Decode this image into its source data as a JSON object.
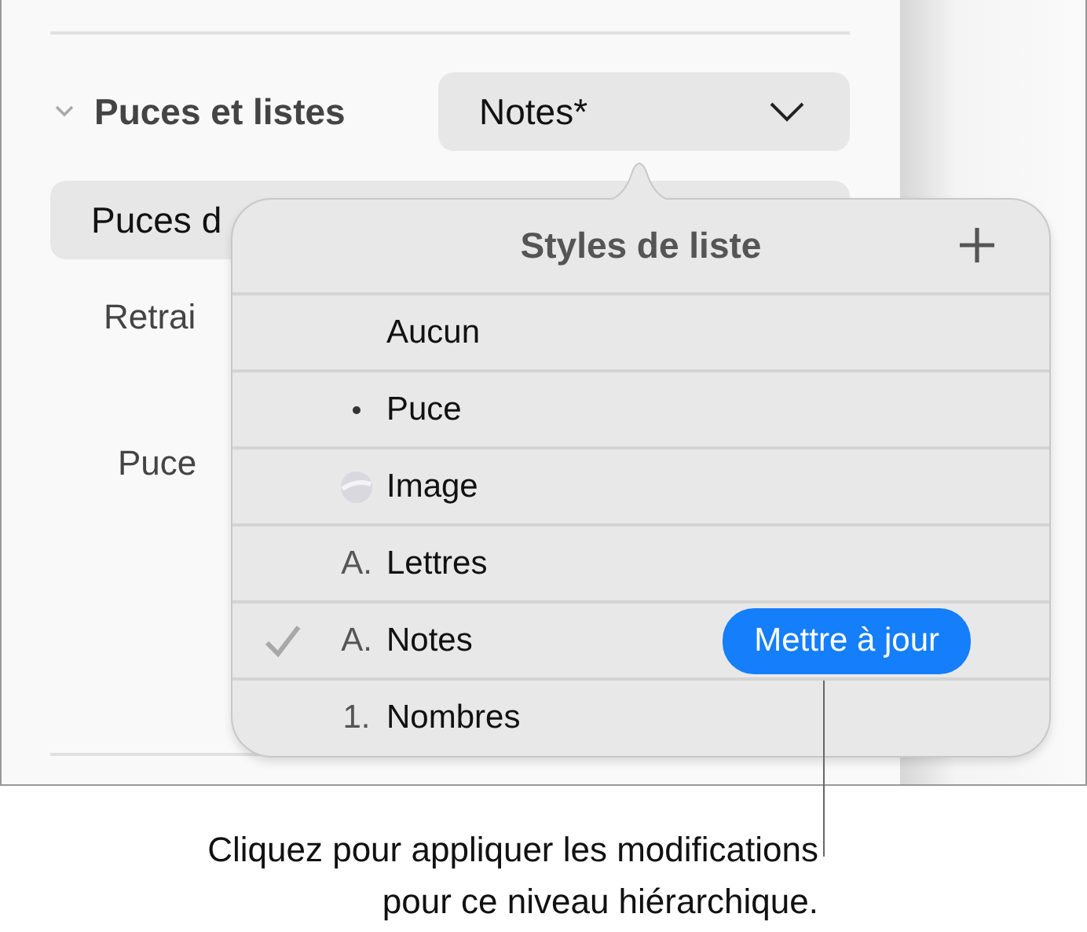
{
  "sidebar": {
    "section_title": "Puces et listes",
    "expanded": true,
    "style_popup": "Notes*",
    "bullet_popup": "Puces d",
    "indent_label": "Retrai",
    "bullet_label": "Puce"
  },
  "popover": {
    "title": "Styles de liste",
    "styles": [
      {
        "kind": "none",
        "label": "Aucun",
        "selected": false
      },
      {
        "kind": "bullet",
        "label": "Puce",
        "selected": false
      },
      {
        "kind": "image",
        "label": "Image",
        "selected": false
      },
      {
        "kind": "letter",
        "marker": "A.",
        "label": "Lettres",
        "selected": false
      },
      {
        "kind": "letter",
        "marker": "A.",
        "label": "Notes",
        "selected": true,
        "update_button": "Mettre à jour"
      },
      {
        "kind": "number",
        "marker": "1.",
        "label": "Nombres",
        "selected": false
      }
    ]
  },
  "callout": "Cliquez pour appliquer les modifications\npour ce niveau hiérarchique."
}
